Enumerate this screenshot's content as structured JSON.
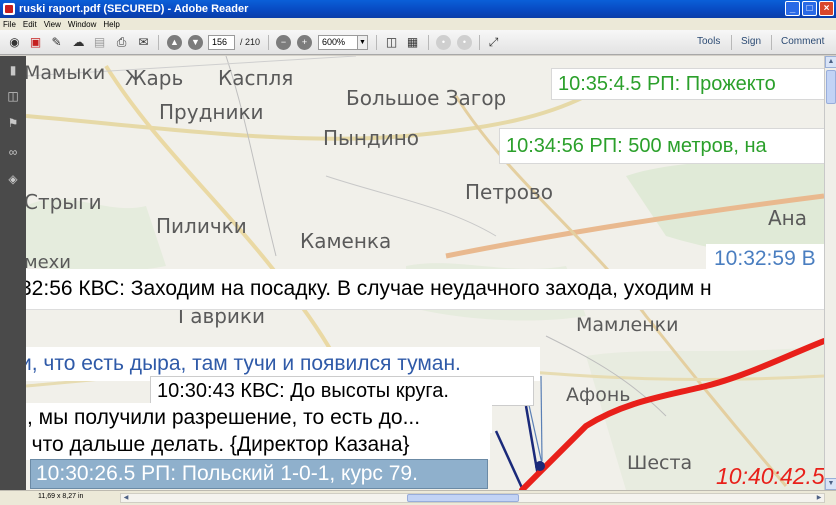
{
  "window": {
    "title": "ruski raport.pdf (SECURED) - Adobe Reader",
    "buttons": {
      "minimize": "_",
      "maximize": "□",
      "close": "×"
    }
  },
  "menu": {
    "items": [
      "File",
      "Edit",
      "View",
      "Window",
      "Help"
    ]
  },
  "toolbar": {
    "page_current": "156",
    "page_total": "/ 210",
    "zoom_value": "600%",
    "tools_label": "Tools",
    "sign_label": "Sign",
    "comment_label": "Comment"
  },
  "map": {
    "places": [
      "Мамыки",
      "Жарь",
      "Каспля",
      "Большое Загор",
      "Прудники",
      "Пындино",
      "Петрово",
      "Стрыги",
      "Пилички",
      "Каменка",
      "Ана",
      "мехи",
      "Гаврики",
      "Мамленки",
      "Афонь",
      "Шеста"
    ]
  },
  "transcript": {
    "line_1": "10:35:4.5 РП: Прожекто",
    "line_2": "10:34:56 РП: 500 метров, на",
    "line_3": "10:32:59 В",
    "line_4": "32:56 КВС:  Заходим на посадку. В случае неудачного захода, уходим н",
    "line_5": "и, что есть дыра, там тучи и появился туман.",
    "line_6": "10:30:43 КВС: До высоты круга.",
    "line_7": "), мы получили разрешение, то есть до...",
    "line_8": ", что дальше делать. {Директор Казана}",
    "line_9": "10:30:26.5 РП: Польский 1-0-1, курс 79.",
    "line_10": "10:40:42.5"
  },
  "statusbar": {
    "page_size": "11,69 x 8,27 in"
  },
  "colors": {
    "title_bar": "#0a50cc",
    "nav_pane": "#4a4a4a",
    "flight_path": "#e8201a",
    "green_text": "#2ba02b",
    "blue_text": "#4a7ec0"
  }
}
